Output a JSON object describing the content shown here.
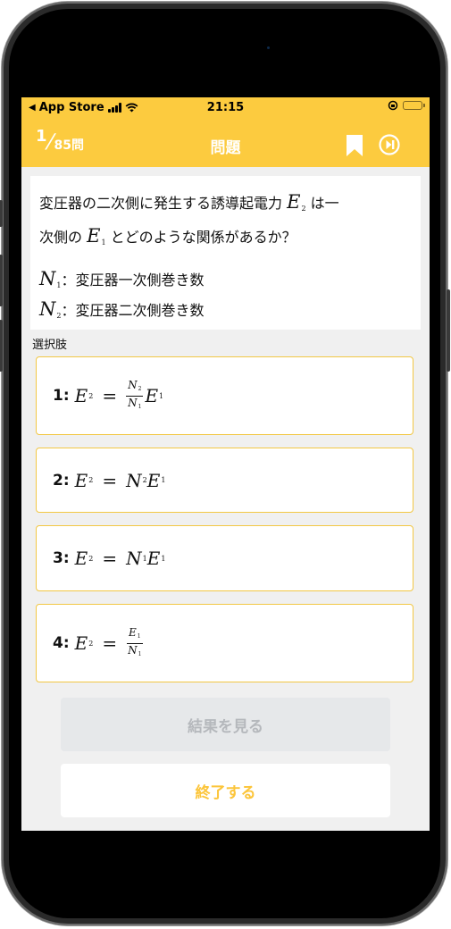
{
  "status_bar": {
    "back_app": "App Store",
    "time": "21:15"
  },
  "nav": {
    "current": "1",
    "slash": "⁄",
    "total": "85問",
    "title": "問題"
  },
  "question": {
    "line1_pre": "変圧器の二次側に発生する誘導起電力",
    "line1_post": "は一",
    "line2_pre": "次側の",
    "line2_post": "とどのような関係があるか？",
    "def1": "：変圧器一次側巻き数",
    "def2": "：変圧器二次側巻き数",
    "sym_E": "E",
    "sym_N": "N",
    "sub1": "1",
    "sub2": "2"
  },
  "options_label": "選択肢",
  "options": [
    {
      "num": "1:"
    },
    {
      "num": "2:"
    },
    {
      "num": "3:"
    },
    {
      "num": "4:"
    }
  ],
  "eq": {
    "E": "E",
    "N": "N",
    "equals": "=",
    "s1": "1",
    "s2": "2"
  },
  "buttons": {
    "result": "結果を見る",
    "end": "終了する"
  },
  "colors": {
    "header": "#fccb3f",
    "accent": "#fcc53a",
    "disabled_bg": "#e6e8ea",
    "content_bg": "#f0f0f0"
  }
}
